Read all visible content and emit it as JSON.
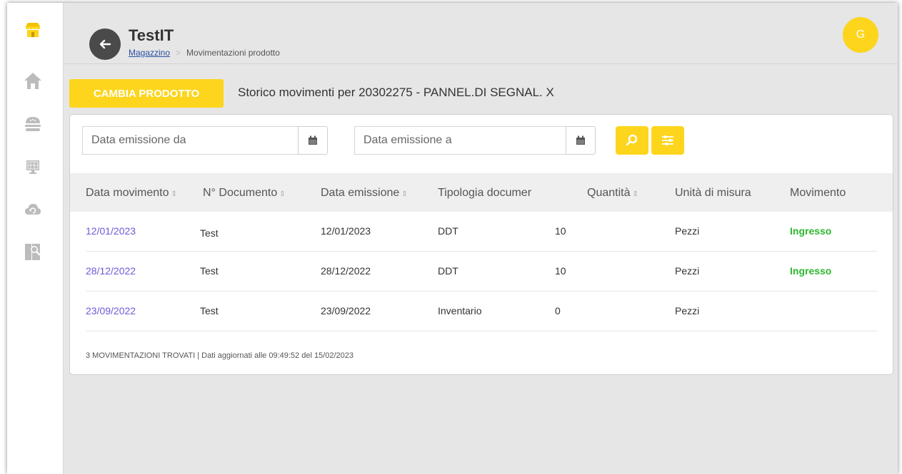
{
  "colors": {
    "accent": "#fdd51c",
    "link": "#6b5bd6",
    "status_in": "#2eb82e",
    "icon": "#bcbcbc"
  },
  "sidebar": {
    "items": [
      {
        "icon": "shop-icon"
      },
      {
        "icon": "home-icon"
      },
      {
        "icon": "food-icon"
      },
      {
        "icon": "monitor-icon"
      },
      {
        "icon": "cloud-icon"
      },
      {
        "icon": "search-document-icon"
      }
    ]
  },
  "header": {
    "title": "TestIT",
    "breadcrumb": {
      "link": "Magazzino",
      "current": "Movimentazioni prodotto"
    },
    "avatar": "G"
  },
  "toolbar": {
    "change_product_label": "CAMBIA PRODOTTO",
    "heading": "Storico movimenti per 20302275 - PANNEL.DI SEGNAL. X"
  },
  "filters": {
    "date_from_placeholder": "Data emissione da",
    "date_to_placeholder": "Data emissione a"
  },
  "table": {
    "columns": [
      "Data movimento",
      "N° Documento",
      "Data emissione",
      "Tipologia documer",
      "Quantità",
      "Unità di misura",
      "Movimento"
    ],
    "rows": [
      [
        "12/01/2023",
        "Test",
        "12/01/2023",
        "DDT",
        "10",
        "Pezzi",
        "Ingresso"
      ],
      [
        "28/12/2022",
        "Test",
        "28/12/2022",
        "DDT",
        "10",
        "Pezzi",
        "Ingresso"
      ],
      [
        "23/09/2022",
        "Test",
        "23/09/2022",
        "Inventario",
        "0",
        "Pezzi",
        ""
      ]
    ]
  },
  "footer": "3 MOVIMENTAZIONI TROVATI | Dati aggiornati alle 09:49:52 del 15/02/2023"
}
